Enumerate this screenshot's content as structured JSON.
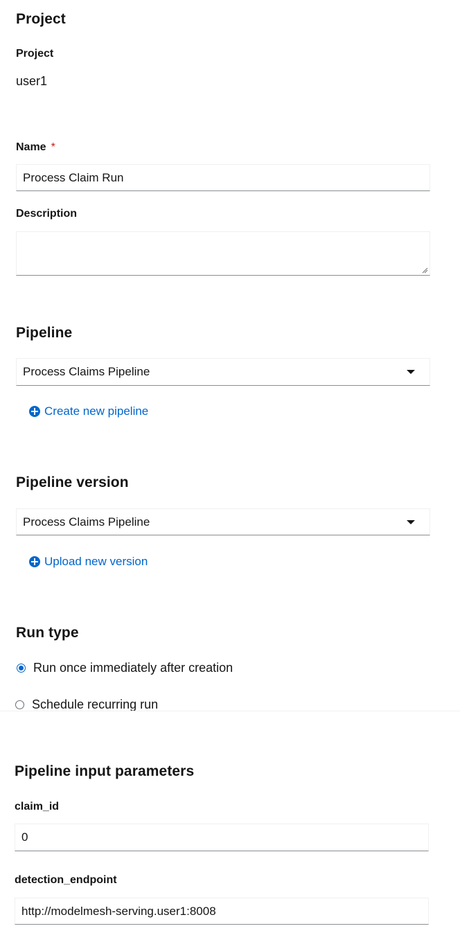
{
  "project_section": {
    "heading": "Project",
    "field_label": "Project",
    "field_value": "user1"
  },
  "name_field": {
    "label": "Name",
    "required_mark": "*",
    "value": "Process Claim Run"
  },
  "description_field": {
    "label": "Description",
    "value": ""
  },
  "pipeline_section": {
    "heading": "Pipeline",
    "selected": "Process Claims Pipeline",
    "create_link": "Create new pipeline"
  },
  "pipeline_version_section": {
    "heading": "Pipeline version",
    "selected": "Process Claims Pipeline",
    "upload_link": "Upload new version"
  },
  "run_type_section": {
    "heading": "Run type",
    "options": [
      {
        "label": "Run once immediately after creation",
        "checked": true
      },
      {
        "label": "Schedule recurring run",
        "checked": false
      }
    ]
  },
  "input_params_section": {
    "heading": "Pipeline input parameters",
    "params": [
      {
        "label": "claim_id",
        "value": "0"
      },
      {
        "label": "detection_endpoint",
        "value": "http://modelmesh-serving.user1:8008"
      }
    ]
  },
  "colors": {
    "link": "#0066cc",
    "required": "#c9190b",
    "radio_selected": "#0066cc"
  }
}
